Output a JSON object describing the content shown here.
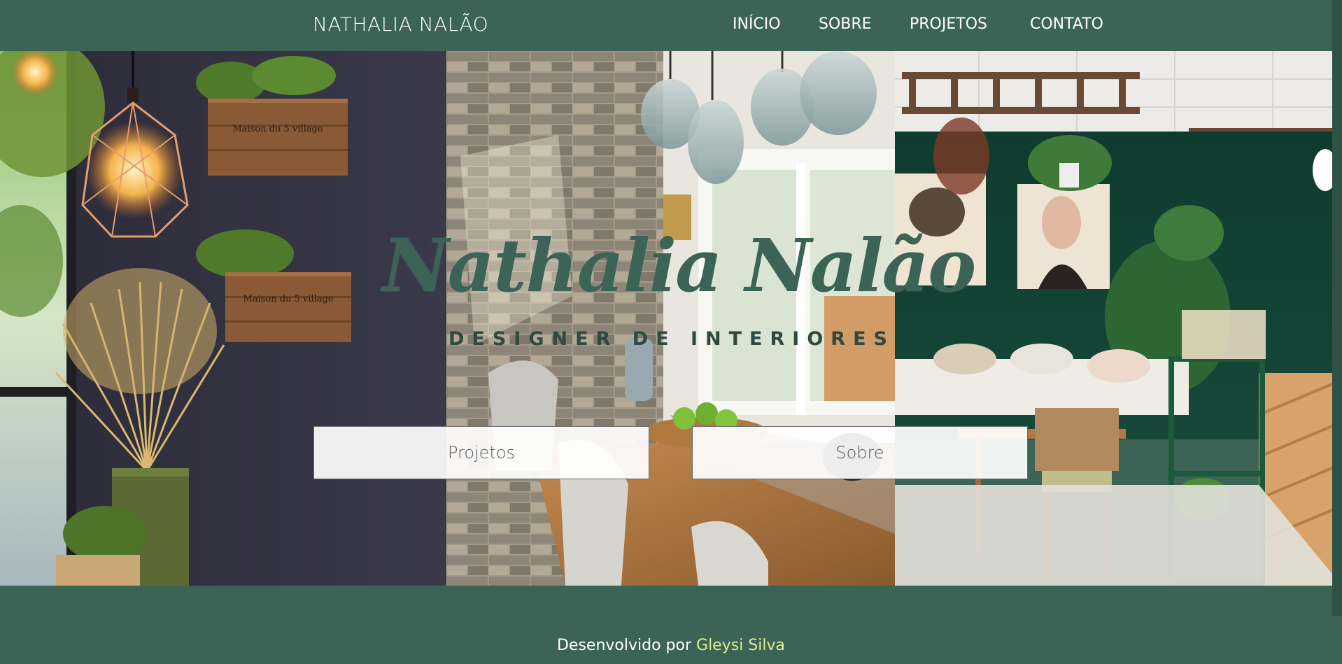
{
  "header": {
    "brand": "NATHALIA NALÃO",
    "nav": [
      {
        "label": "INÍCIO"
      },
      {
        "label": "SOBRE"
      },
      {
        "label": "PROJETOS"
      },
      {
        "label": "CONTATO"
      }
    ]
  },
  "hero": {
    "title": "Nathalia Nalão",
    "subtitle": "DESIGNER DE INTERIORES",
    "buttons": [
      {
        "label": "Projetos"
      },
      {
        "label": "Sobre"
      }
    ]
  },
  "footer": {
    "text": "Desenvolvido por",
    "author": "Gleysi Silva"
  },
  "colors": {
    "primary": "#3c6456",
    "footer_link": "#d9ef8f",
    "white": "#ffffff"
  },
  "icons": [
    "pendant-lamp-icon",
    "wood-crate-icon",
    "wheat-vase-icon"
  ]
}
